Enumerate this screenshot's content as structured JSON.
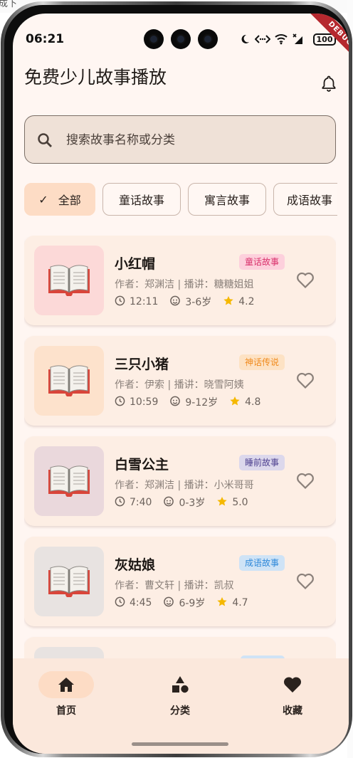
{
  "browser_fragment": "成下",
  "status_bar": {
    "time": "06:21",
    "battery": "100",
    "debug_banner": "DEBUG"
  },
  "app": {
    "title": "免费少儿故事播放"
  },
  "search": {
    "placeholder": "搜索故事名称或分类"
  },
  "categories": [
    {
      "label": "全部",
      "selected": true
    },
    {
      "label": "童话故事",
      "selected": false
    },
    {
      "label": "寓言故事",
      "selected": false
    },
    {
      "label": "成语故事",
      "selected": false
    }
  ],
  "stories": [
    {
      "title": "小红帽",
      "tag": "童话故事",
      "tag_bg": "#fdd0dc",
      "tag_color": "#d9306b",
      "cover_bg": "#fcd9d8",
      "meta": "作者：郑渊洁 | 播讲：糖糖姐姐",
      "duration": "12:11",
      "age": "3-6岁",
      "rating": "4.2"
    },
    {
      "title": "三只小猪",
      "tag": "神话传说",
      "tag_bg": "#fde2c4",
      "tag_color": "#f08a1c",
      "cover_bg": "#fde2cc",
      "meta": "作者：伊索 | 播讲：晓雪阿姨",
      "duration": "10:59",
      "age": "9-12岁",
      "rating": "4.8"
    },
    {
      "title": "白雪公主",
      "tag": "睡前故事",
      "tag_bg": "#dcd8ec",
      "tag_color": "#4c3f8f",
      "cover_bg": "#ead8dc",
      "meta": "作者：郑渊洁 | 播讲：小米哥哥",
      "duration": "7:40",
      "age": "0-3岁",
      "rating": "5.0"
    },
    {
      "title": "灰姑娘",
      "tag": "成语故事",
      "tag_bg": "#cfe3f6",
      "tag_color": "#2e88d9",
      "cover_bg": "#e8e3e1",
      "meta": "作者：曹文轩 | 播讲：凯叔",
      "duration": "4:45",
      "age": "6-9岁",
      "rating": "4.7"
    },
    {
      "title": "",
      "tag": "",
      "tag_bg": "#cfe3f6",
      "tag_color": "#2e88d9",
      "cover_bg": "#e8e3e1",
      "meta": "",
      "duration": "",
      "age": "",
      "rating": ""
    }
  ],
  "bottom_nav": [
    {
      "label": "首页",
      "icon": "home-icon",
      "active": true
    },
    {
      "label": "分类",
      "icon": "shapes-icon",
      "active": false
    },
    {
      "label": "收藏",
      "icon": "heart-filled-icon",
      "active": false
    }
  ],
  "colors": {
    "accent": "#fddcc5",
    "background": "#fff6f2",
    "card": "#fdeee4",
    "star": "#f5b800"
  }
}
